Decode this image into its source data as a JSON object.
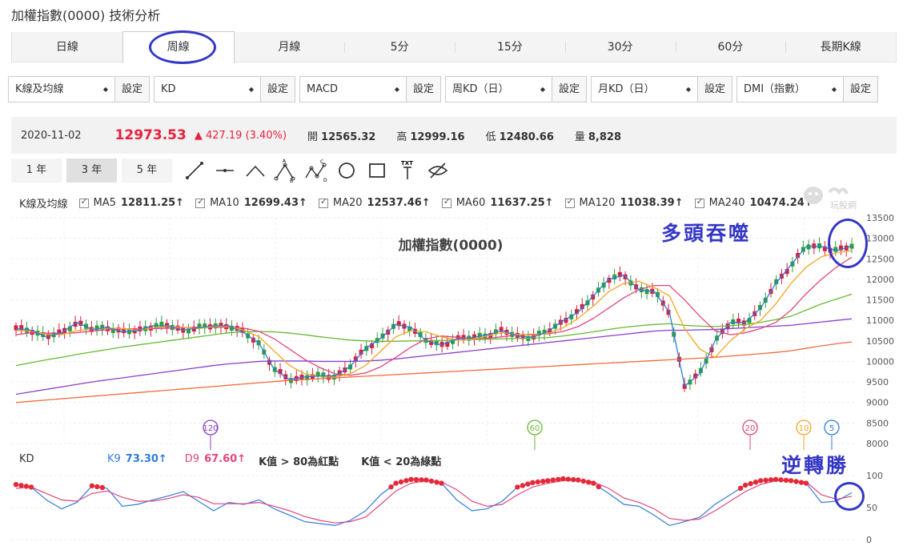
{
  "page": {
    "title": "加權指數(0000) 技術分析"
  },
  "period_tabs": [
    "日線",
    "周線",
    "月線",
    "5分",
    "15分",
    "30分",
    "60分",
    "長期K線"
  ],
  "active_period": "周線",
  "selectors": [
    {
      "value": "K線及均線",
      "button": "設定"
    },
    {
      "value": "KD",
      "button": "設定"
    },
    {
      "value": "MACD",
      "button": "設定"
    },
    {
      "value": "周KD（日）",
      "button": "設定"
    },
    {
      "value": "月KD（日）",
      "button": "設定"
    },
    {
      "value": "DMI（指數）",
      "button": "設定"
    }
  ],
  "quote": {
    "date": "2020-11-02",
    "price": "12973.53",
    "change": "▲ 427.19 (3.40%)",
    "open_label": "開",
    "open": "12565.32",
    "high_label": "高",
    "high": "12999.16",
    "low_label": "低",
    "low": "12480.66",
    "volume_label": "量",
    "volume": "8,828"
  },
  "range_buttons": [
    "1 年",
    "3 年",
    "5 年"
  ],
  "active_range": "3 年",
  "draw_tools": [
    "line-tool-icon",
    "segment-tool-icon",
    "angle-tool-icon",
    "abc-pattern-icon",
    "abcd-pattern-icon",
    "circle-tool-icon",
    "rectangle-tool-icon",
    "text-tool-icon",
    "hide-icon"
  ],
  "ma_legend": {
    "label": "K線及均線",
    "items": [
      {
        "name": "MA5",
        "value": "12811.25↑",
        "color": "#2f7cde"
      },
      {
        "name": "MA10",
        "value": "12699.43↑",
        "color": "#f5a623"
      },
      {
        "name": "MA20",
        "value": "12537.46↑",
        "color": "#e0467c"
      },
      {
        "name": "MA60",
        "value": "11637.25↑",
        "color": "#67b932"
      },
      {
        "name": "MA120",
        "value": "11038.39↑",
        "color": "#8a3fc9"
      },
      {
        "name": "MA240",
        "value": "10474.24↑",
        "color": "#f36a3d"
      }
    ]
  },
  "logo_text": "玩股網",
  "annotations": {
    "top": "多頭吞噬",
    "bottom": "逆轉勝"
  },
  "chart_data": [
    {
      "type": "candlestick",
      "title": "加權指數(0000)",
      "y_ticks": [
        "13500",
        "13000",
        "12500",
        "12000",
        "11500",
        "11000",
        "10500",
        "10000",
        "9500",
        "9000",
        "8500",
        "8000"
      ],
      "ylim": [
        8000,
        13500
      ],
      "markers": [
        {
          "label": "120",
          "color": "#8a3fc9"
        },
        {
          "label": "60",
          "color": "#67b932"
        },
        {
          "label": "20",
          "color": "#e0467c"
        },
        {
          "label": "10",
          "color": "#f5a623"
        },
        {
          "label": "5",
          "color": "#2f7cde"
        }
      ],
      "series": [
        {
          "name": "MA5",
          "color": "#2f7cde",
          "values": [
            10800,
            10760,
            10600,
            10700,
            10950,
            10780,
            10830,
            10720,
            10750,
            10870,
            10870,
            10760,
            10820,
            10870,
            10870,
            10700,
            10440,
            9800,
            9560,
            9620,
            9650,
            9640,
            9880,
            10320,
            10560,
            10900,
            10830,
            10500,
            10400,
            10550,
            10580,
            10650,
            10750,
            10620,
            10590,
            10730,
            10990,
            11200,
            11600,
            12000,
            12100,
            11750,
            11700,
            11200,
            9400,
            9700,
            10500,
            10950,
            10950,
            11300,
            11900,
            12350,
            12800,
            12800,
            12700,
            12811
          ]
        },
        {
          "name": "MA10",
          "color": "#f5a623",
          "values": [
            10750,
            10740,
            10660,
            10650,
            10750,
            10790,
            10810,
            10800,
            10760,
            10820,
            10850,
            10830,
            10800,
            10850,
            10850,
            10760,
            10600,
            10250,
            9900,
            9700,
            9640,
            9620,
            9700,
            9900,
            10250,
            10600,
            10750,
            10720,
            10600,
            10520,
            10530,
            10620,
            10700,
            10660,
            10640,
            10680,
            10820,
            11050,
            11350,
            11700,
            11900,
            11950,
            11800,
            11600,
            10800,
            10300,
            10100,
            10500,
            10800,
            11000,
            11400,
            11900,
            12300,
            12550,
            12650,
            12699
          ]
        },
        {
          "name": "MA20",
          "color": "#e0467c",
          "values": [
            10650,
            10700,
            10690,
            10680,
            10700,
            10740,
            10770,
            10790,
            10790,
            10800,
            10810,
            10820,
            10830,
            10830,
            10830,
            10810,
            10730,
            10550,
            10300,
            10050,
            9850,
            9700,
            9660,
            9720,
            9870,
            10100,
            10350,
            10550,
            10620,
            10590,
            10560,
            10560,
            10600,
            10650,
            10660,
            10670,
            10730,
            10850,
            11050,
            11300,
            11550,
            11750,
            11850,
            11850,
            11500,
            11100,
            10750,
            10650,
            10700,
            10800,
            10950,
            11250,
            11650,
            12000,
            12300,
            12537
          ]
        },
        {
          "name": "MA60",
          "color": "#67b932",
          "values": [
            9900,
            9970,
            10040,
            10100,
            10170,
            10230,
            10290,
            10350,
            10400,
            10450,
            10500,
            10550,
            10600,
            10650,
            10700,
            10720,
            10730,
            10720,
            10690,
            10650,
            10600,
            10560,
            10520,
            10500,
            10490,
            10490,
            10500,
            10500,
            10510,
            10520,
            10530,
            10540,
            10550,
            10560,
            10570,
            10580,
            10620,
            10670,
            10720,
            10780,
            10830,
            10870,
            10900,
            10920,
            10880,
            10860,
            10850,
            10870,
            10900,
            10950,
            11020,
            11100,
            11250,
            11400,
            11520,
            11637
          ]
        },
        {
          "name": "MA120",
          "color": "#8a3fc9",
          "values": [
            9200,
            9260,
            9320,
            9380,
            9440,
            9500,
            9550,
            9600,
            9650,
            9700,
            9750,
            9800,
            9850,
            9900,
            9940,
            9970,
            10000,
            10010,
            10010,
            10010,
            10000,
            10000,
            10000,
            10010,
            10030,
            10060,
            10100,
            10140,
            10180,
            10220,
            10260,
            10300,
            10340,
            10380,
            10420,
            10460,
            10500,
            10540,
            10580,
            10620,
            10660,
            10700,
            10740,
            10760,
            10760,
            10770,
            10780,
            10800,
            10820,
            10840,
            10860,
            10880,
            10920,
            10960,
            11000,
            11038
          ]
        },
        {
          "name": "MA240",
          "color": "#f36a3d",
          "values": [
            9000,
            9030,
            9060,
            9090,
            9120,
            9150,
            9180,
            9210,
            9240,
            9270,
            9300,
            9330,
            9360,
            9390,
            9420,
            9450,
            9480,
            9510,
            9540,
            9560,
            9580,
            9600,
            9620,
            9640,
            9660,
            9680,
            9700,
            9720,
            9740,
            9760,
            9780,
            9800,
            9820,
            9840,
            9860,
            9880,
            9900,
            9920,
            9940,
            9960,
            9980,
            10000,
            10020,
            10040,
            10060,
            10080,
            10100,
            10130,
            10160,
            10190,
            10220,
            10260,
            10320,
            10380,
            10430,
            10474
          ]
        }
      ]
    },
    {
      "type": "line",
      "title": "KD",
      "y_ticks": [
        "100",
        "50",
        "0"
      ],
      "ylim": [
        0,
        100
      ],
      "notes": [
        "K值 > 80為紅點",
        "K值 < 20為綠點"
      ],
      "series": [
        {
          "name": "K9",
          "label": "K9",
          "value_text": "73.30↑",
          "color": "#2f7cde",
          "values": [
            86,
            82,
            62,
            48,
            58,
            84,
            80,
            52,
            55,
            62,
            68,
            75,
            60,
            45,
            58,
            55,
            62,
            48,
            38,
            28,
            25,
            22,
            30,
            45,
            70,
            88,
            94,
            93,
            88,
            62,
            45,
            48,
            60,
            82,
            89,
            92,
            95,
            93,
            88,
            72,
            55,
            52,
            38,
            22,
            28,
            35,
            55,
            70,
            85,
            92,
            94,
            92,
            88,
            58,
            60,
            73.3
          ]
        },
        {
          "name": "D9",
          "label": "D9",
          "value_text": "67.60↑",
          "color": "#e0467c",
          "values": [
            80,
            82,
            72,
            62,
            60,
            72,
            76,
            66,
            60,
            60,
            64,
            70,
            66,
            56,
            56,
            56,
            58,
            52,
            45,
            36,
            30,
            26,
            28,
            35,
            55,
            76,
            88,
            92,
            90,
            78,
            60,
            52,
            55,
            70,
            82,
            88,
            92,
            93,
            90,
            80,
            65,
            58,
            48,
            33,
            30,
            32,
            45,
            60,
            75,
            86,
            92,
            92,
            90,
            70,
            63,
            67.6
          ]
        }
      ]
    }
  ]
}
